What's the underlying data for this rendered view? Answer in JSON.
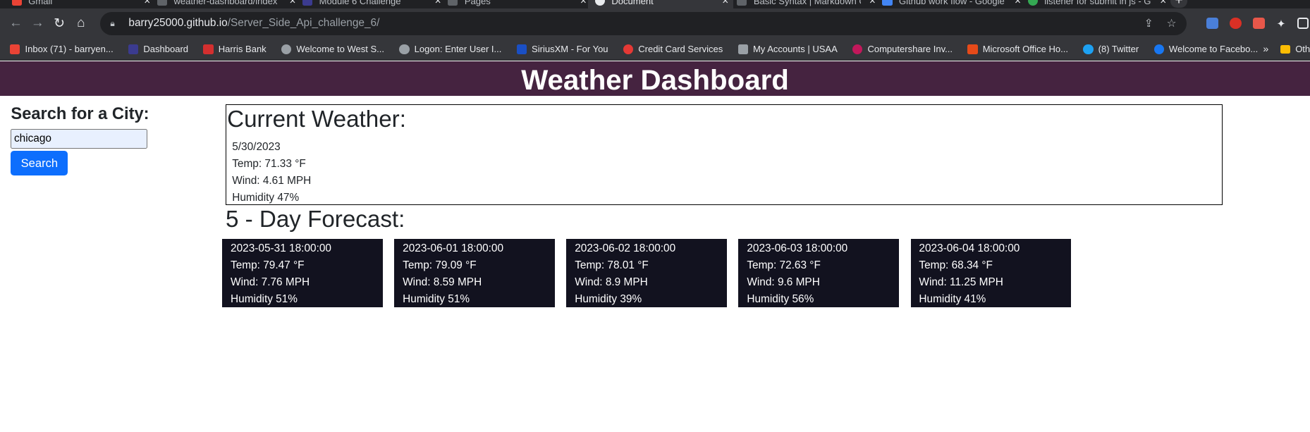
{
  "browser": {
    "tabs": [
      {
        "title": "Gmail",
        "color": "#ea4335"
      },
      {
        "title": "weather-dashboard/index",
        "color": "#5f6368"
      },
      {
        "title": "Module 6 Challenge",
        "color": "#3b3b8f"
      },
      {
        "title": "Pages",
        "color": "#5f6368"
      },
      {
        "title": "Document",
        "color": "#e8eaed"
      },
      {
        "title": "Basic Syntax | Markdown G",
        "color": "#5f6368"
      },
      {
        "title": "Github work flow - Google",
        "color": "#4285f4"
      },
      {
        "title": "listener for submit in js - G",
        "color": "#34a853"
      }
    ],
    "url_host": "barry25000.github.io",
    "url_path": "/Server_Side_Api_challenge_6/",
    "bookmarks": [
      {
        "label": "Inbox (71) - barryen...",
        "color": "#ea4335"
      },
      {
        "label": "Dashboard",
        "color": "#3b3b8f"
      },
      {
        "label": "Harris Bank",
        "color": "#d32f2f"
      },
      {
        "label": "Welcome to West S...",
        "color": "#9aa0a6"
      },
      {
        "label": "Logon: Enter User I...",
        "color": "#9aa0a6"
      },
      {
        "label": "SiriusXM - For You",
        "color": "#1a4fc4"
      },
      {
        "label": "Credit Card Services",
        "color": "#e53935"
      },
      {
        "label": "My Accounts | USAA",
        "color": "#9aa0a6"
      },
      {
        "label": "Computershare Inv...",
        "color": "#c2185b"
      },
      {
        "label": "Microsoft Office Ho...",
        "color": "#e64a19"
      },
      {
        "label": "(8) Twitter",
        "color": "#1da1f2"
      },
      {
        "label": "Welcome to Facebo...",
        "color": "#1877f2"
      }
    ],
    "bookmarks_more": "»",
    "other_bookmarks": "Other b"
  },
  "app": {
    "title": "Weather Dashboard",
    "accent_color": "#452340"
  },
  "search": {
    "heading": "Search for a City:",
    "value": "chicago",
    "button_label": "Search"
  },
  "current": {
    "heading": "Current Weather:",
    "date": "5/30/2023",
    "temp": "Temp: 71.33 °F",
    "wind": "Wind: 4.61 MPH",
    "humidity": "Humidity 47%"
  },
  "forecast": {
    "heading": "5 - Day Forecast:",
    "days": [
      {
        "date": "2023-05-31 18:00:00",
        "temp": "Temp: 79.47 °F",
        "wind": "Wind: 7.76 MPH",
        "humidity": "Humidity 51%"
      },
      {
        "date": "2023-06-01 18:00:00",
        "temp": "Temp: 79.09 °F",
        "wind": "Wind: 8.59 MPH",
        "humidity": "Humidity 51%"
      },
      {
        "date": "2023-06-02 18:00:00",
        "temp": "Temp: 78.01 °F",
        "wind": "Wind: 8.9 MPH",
        "humidity": "Humidity 39%"
      },
      {
        "date": "2023-06-03 18:00:00",
        "temp": "Temp: 72.63 °F",
        "wind": "Wind: 9.6 MPH",
        "humidity": "Humidity 56%"
      },
      {
        "date": "2023-06-04 18:00:00",
        "temp": "Temp: 68.34 °F",
        "wind": "Wind: 11.25 MPH",
        "humidity": "Humidity 41%"
      }
    ]
  }
}
